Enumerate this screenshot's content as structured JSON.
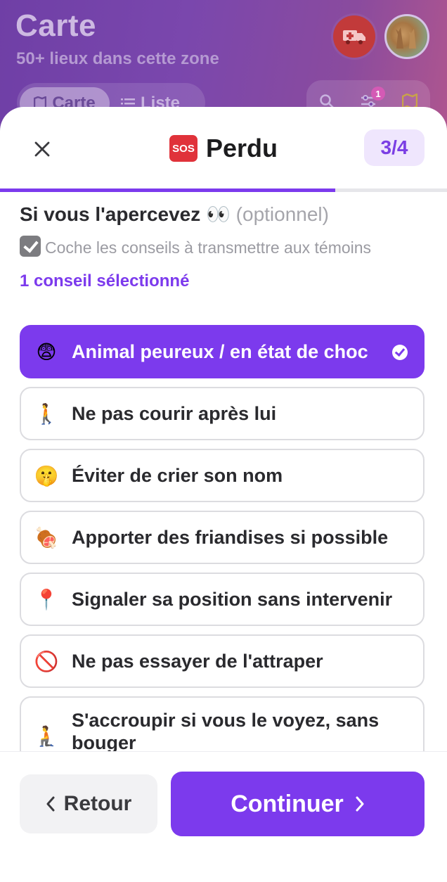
{
  "background": {
    "title": "Carte",
    "subtitle": "50+ lieux dans cette zone",
    "toggle": {
      "map_label": "Carte",
      "list_label": "Liste"
    },
    "filter_badge": "1"
  },
  "modal": {
    "title": "Perdu",
    "sos_label": "SOS",
    "step": "3/4",
    "progress": 0.75,
    "section_title": "Si vous l'apercevez 👀",
    "section_optional": "(optionnel)",
    "hint": "Coche les conseils à transmettre aux témoins",
    "selected_count": "1 conseil sélectionné",
    "options": [
      {
        "emoji": "😨",
        "label": "Animal peureux / en état de choc",
        "selected": true
      },
      {
        "emoji": "🚶",
        "label": "Ne pas courir après lui",
        "selected": false
      },
      {
        "emoji": "🤫",
        "label": "Éviter de crier son nom",
        "selected": false
      },
      {
        "emoji": "🍖",
        "label": "Apporter des friandises si possible",
        "selected": false
      },
      {
        "emoji": "📍",
        "label": "Signaler sa position sans intervenir",
        "selected": false
      },
      {
        "emoji": "🚫",
        "label": "Ne pas essayer de l'attraper",
        "selected": false
      },
      {
        "emoji": "🧎",
        "label": "S'accroupir si vous le voyez, sans bouger",
        "selected": false
      }
    ],
    "back_label": "Retour",
    "continue_label": "Continuer"
  },
  "colors": {
    "accent": "#7c3aed",
    "accent_light": "#efe6fd",
    "emergency": "#c23a3a",
    "sos": "#e0323a"
  }
}
